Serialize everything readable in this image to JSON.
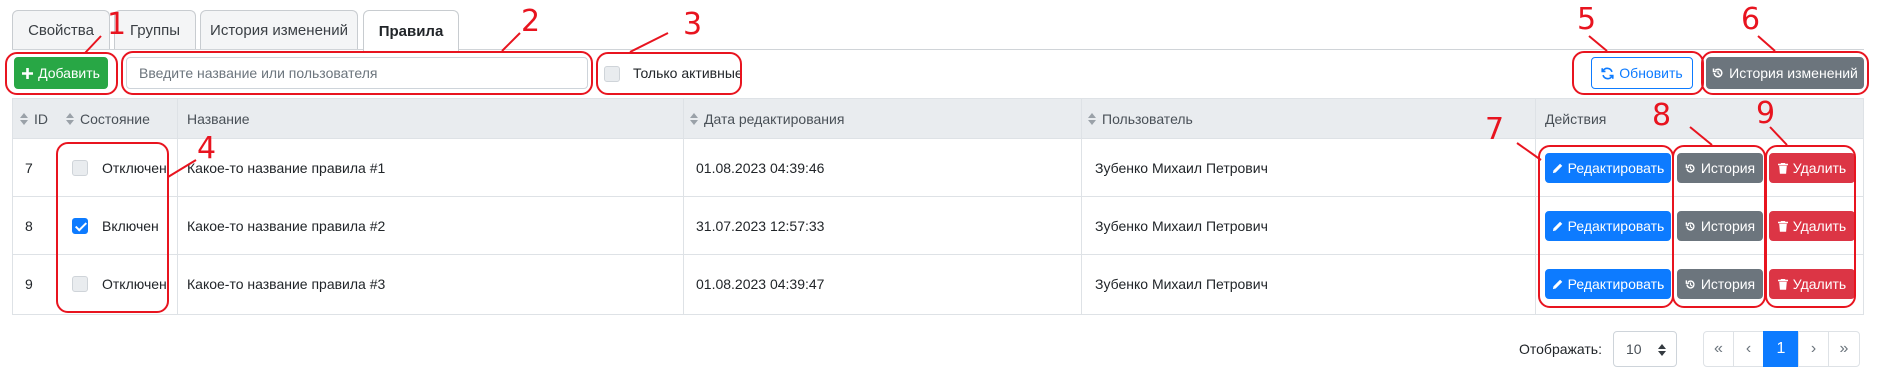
{
  "tabs": [
    {
      "label": "Свойства",
      "active": false
    },
    {
      "label": "Группы",
      "active": false
    },
    {
      "label": "История изменений",
      "active": false
    },
    {
      "label": "Правила",
      "active": true
    }
  ],
  "toolbar": {
    "add_label": "Добавить",
    "search_placeholder": "Введите название или пользователя",
    "search_value": "",
    "only_active_label": "Только активные",
    "only_active_checked": false,
    "refresh_label": "Обновить",
    "history_label": "История изменений"
  },
  "table": {
    "columns": [
      "ID",
      "Состояние",
      "Название",
      "Дата редактирования",
      "Пользователь",
      "Действия"
    ],
    "rows": [
      {
        "id": "7",
        "enabled": false,
        "state": "Отключен",
        "name": "Какое-то название правила #1",
        "date": "01.08.2023 04:39:46",
        "user": "Зубенко Михаил Петрович"
      },
      {
        "id": "8",
        "enabled": true,
        "state": "Включен",
        "name": "Какое-то название правила #2",
        "date": "31.07.2023 12:57:33",
        "user": "Зубенко Михаил Петрович"
      },
      {
        "id": "9",
        "enabled": false,
        "state": "Отключен",
        "name": "Какое-то название правила #3",
        "date": "01.08.2023 04:39:47",
        "user": "Зубенко Михаил Петрович"
      }
    ],
    "actions": {
      "edit": "Редактировать",
      "history": "История",
      "delete": "Удалить"
    }
  },
  "pagination": {
    "show_label": "Отображать:",
    "page_size": "10",
    "first": "«",
    "prev": "‹",
    "current": "1",
    "next": "›",
    "last": "»"
  },
  "annotations": [
    "1",
    "2",
    "3",
    "4",
    "5",
    "6",
    "7",
    "8",
    "9"
  ],
  "colors": {
    "success": "#28a745",
    "primary": "#0d7bff",
    "secondary": "#6c757d",
    "danger": "#dc3545",
    "annotation": "#e8141f"
  },
  "icons": {
    "add": "plus-icon",
    "refresh": "refresh-icon",
    "history": "history-icon",
    "edit": "pencil-icon",
    "delete": "trash-icon",
    "sort": "sort-icon",
    "select": "select-arrows-icon"
  }
}
